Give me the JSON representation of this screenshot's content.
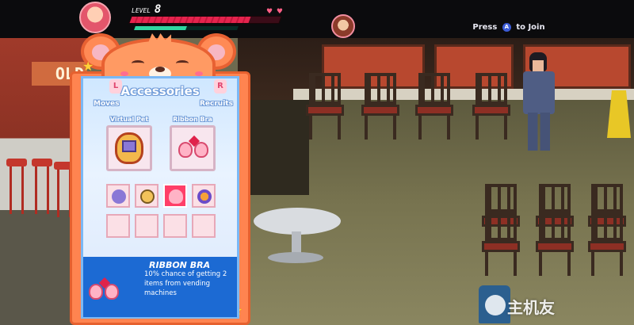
{
  "hud": {
    "level_label": "LEVEL",
    "level_value": "8",
    "health_fraction": 0.8,
    "special_fraction": 0.5,
    "hearts": "♥ ♥"
  },
  "join_prompt": {
    "press": "Press",
    "button": "A",
    "to_join": "to Join"
  },
  "scene": {
    "store_sign": "OLD"
  },
  "panel": {
    "title": "Accessories",
    "left_tab_button": "L",
    "right_tab_button": "R",
    "left_tab": "Moves",
    "right_tab": "Recruits",
    "equipped": [
      {
        "label": "Virtual Pet",
        "icon": "virtual-pet-icon"
      },
      {
        "label": "Ribbon Bra",
        "icon": "ribbon-bra-icon"
      }
    ],
    "inventory": [
      {
        "icon": "pet-toy-icon",
        "selected": false
      },
      {
        "icon": "mirror-icon",
        "selected": false
      },
      {
        "icon": "ribbon-bra-icon",
        "selected": true
      },
      {
        "icon": "bead-bracelet-icon",
        "selected": false
      },
      {
        "icon": "empty",
        "selected": false
      },
      {
        "icon": "empty",
        "selected": false
      },
      {
        "icon": "empty",
        "selected": false
      },
      {
        "icon": "empty",
        "selected": false
      }
    ],
    "selected_item": {
      "name": "RIBBON BRA",
      "description": "10% chance of getting 2 items from vending machines"
    }
  },
  "watermark": "主机友",
  "colors": {
    "panel_orange": "#ff8450",
    "panel_blue": "#1c6ad3",
    "health_red": "#e5244e",
    "special_green": "#2fd6a0"
  }
}
